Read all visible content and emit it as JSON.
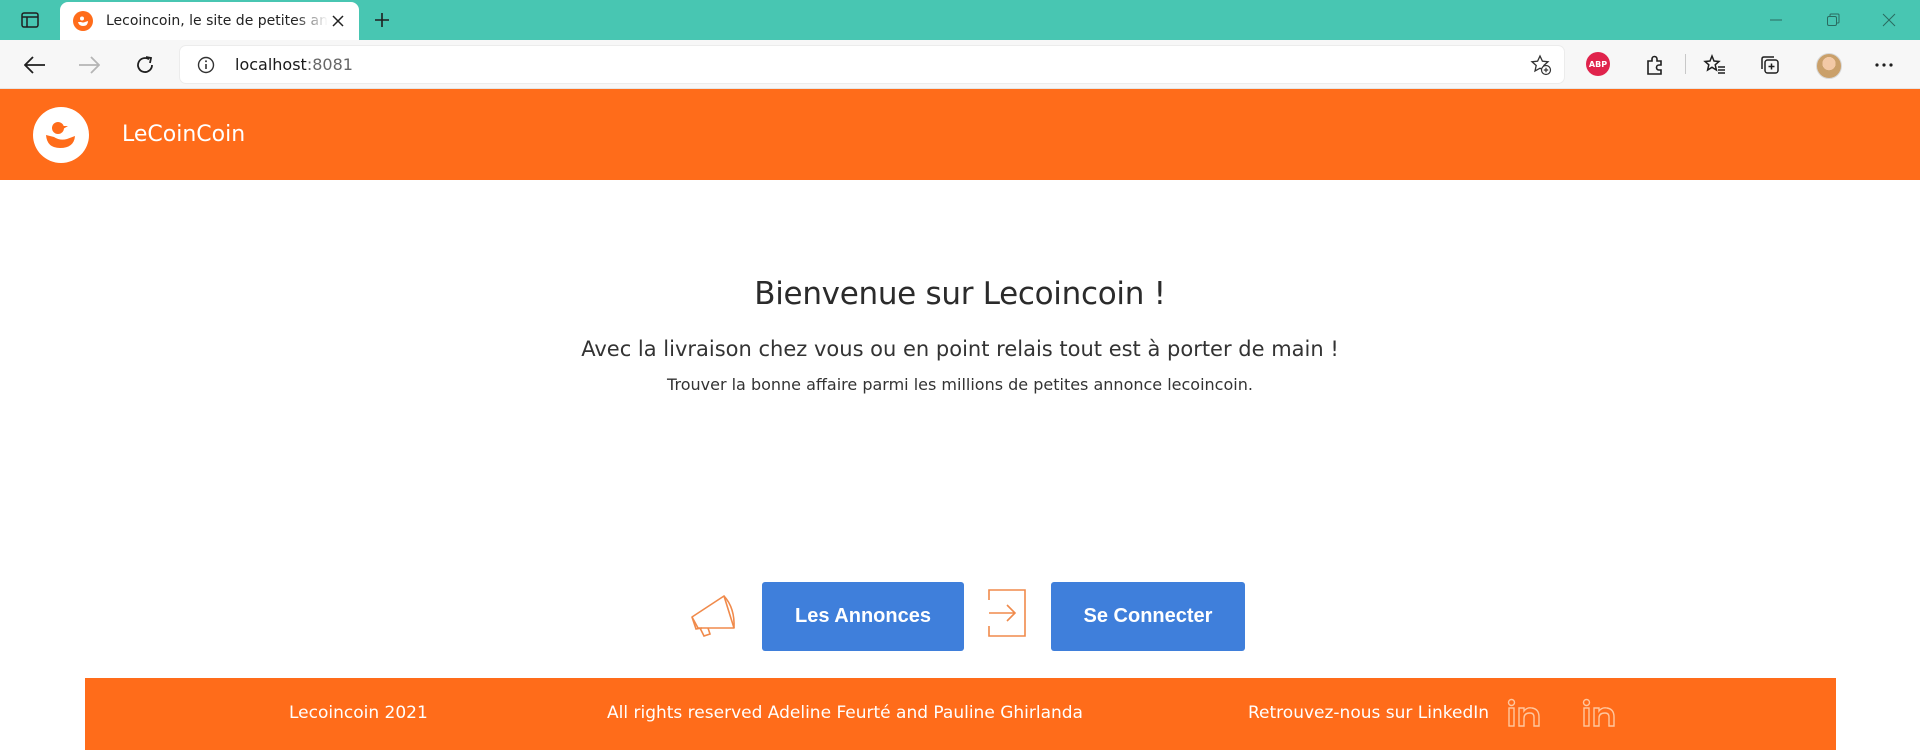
{
  "browser": {
    "tab": {
      "title": "Lecoincoin, le site de petites annonces"
    },
    "address": {
      "host": "localhost",
      "port": ":8081"
    },
    "extensions": {
      "abp_label": "ABP"
    }
  },
  "header": {
    "brand": "LeCoinCoin"
  },
  "hero": {
    "title": "Bienvenue sur Lecoincoin !",
    "lead": "Avec la livraison chez vous ou en point relais tout est à porter de main !",
    "sub": "Trouver la bonne affaire parmi les millions de petites annonce lecoincoin."
  },
  "actions": {
    "annonces_label": "Les Annonces",
    "connect_label": "Se Connecter"
  },
  "footer": {
    "copyright": "Lecoincoin 2021",
    "rights": "All rights reserved Adeline Feurté and Pauline Ghirlanda",
    "linkedin_text": "Retrouvez-nous sur LinkedIn"
  },
  "colors": {
    "accent": "#ff6c1a",
    "button": "#3f7fdb",
    "tabbar": "#48c6b2"
  }
}
